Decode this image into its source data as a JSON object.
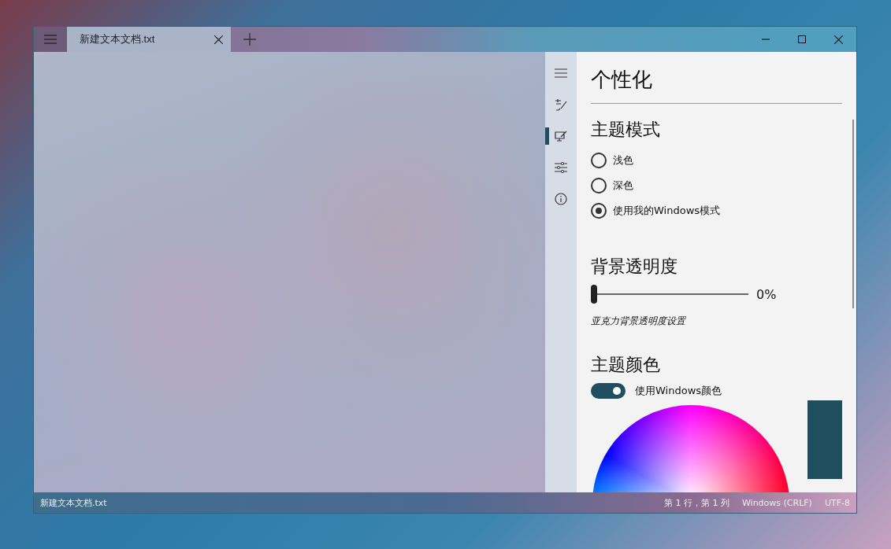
{
  "window": {
    "tab": {
      "title": "新建文本文档.txt",
      "selected": true
    }
  },
  "nav_items": [
    {
      "kind": "menu",
      "selected": false
    },
    {
      "kind": "text",
      "selected": false
    },
    {
      "kind": "personalize",
      "selected": true
    },
    {
      "kind": "sliders",
      "selected": false
    },
    {
      "kind": "info",
      "selected": false
    }
  ],
  "settings": {
    "title": "个性化",
    "theme_mode": {
      "heading": "主题模式",
      "options": [
        {
          "label": "浅色",
          "selected": false
        },
        {
          "label": "深色",
          "selected": false
        },
        {
          "label": "使用我的Windows模式",
          "selected": true
        }
      ]
    },
    "background_opacity": {
      "heading": "背景透明度",
      "level": 0,
      "reading": "0%",
      "caption": "亚克力背景透明度设置"
    },
    "theme_color": {
      "heading": "主题颜色",
      "toggle": {
        "label": "使用Windows颜色",
        "on": true
      }
    }
  },
  "status_bar": {
    "file_name": "新建文本文档.txt",
    "position": "第 1 行，第 1 列",
    "line_ending": "Windows (CRLF)",
    "encoding": "UTF-8"
  }
}
